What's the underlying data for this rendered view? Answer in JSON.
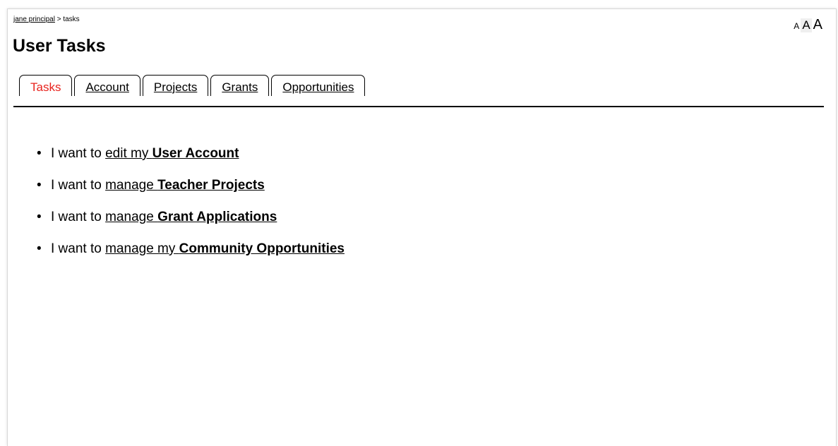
{
  "breadcrumb": {
    "user_link": "jane principal",
    "separator": " > ",
    "current": "tasks"
  },
  "page_title": "User Tasks",
  "font_sizer": {
    "small": "A",
    "medium": "A",
    "large": "A",
    "selected": "medium"
  },
  "tabs": [
    {
      "label": "Tasks",
      "active": true
    },
    {
      "label": "Account",
      "active": false
    },
    {
      "label": "Projects",
      "active": false
    },
    {
      "label": "Grants",
      "active": false
    },
    {
      "label": "Opportunities",
      "active": false
    }
  ],
  "tasks": [
    {
      "prefix": "I want to ",
      "link_text": "edit my ",
      "link_bold": "User Account"
    },
    {
      "prefix": "I want to ",
      "link_text": "manage ",
      "link_bold": "Teacher Projects"
    },
    {
      "prefix": "I want to ",
      "link_text": "manage ",
      "link_bold": "Grant Applications"
    },
    {
      "prefix": "I want to ",
      "link_text": "manage my ",
      "link_bold": "Community Opportunities"
    }
  ],
  "bullet_char": "•",
  "colors": {
    "active_tab": "#e8231e",
    "text": "#000000",
    "background": "#ffffff"
  }
}
